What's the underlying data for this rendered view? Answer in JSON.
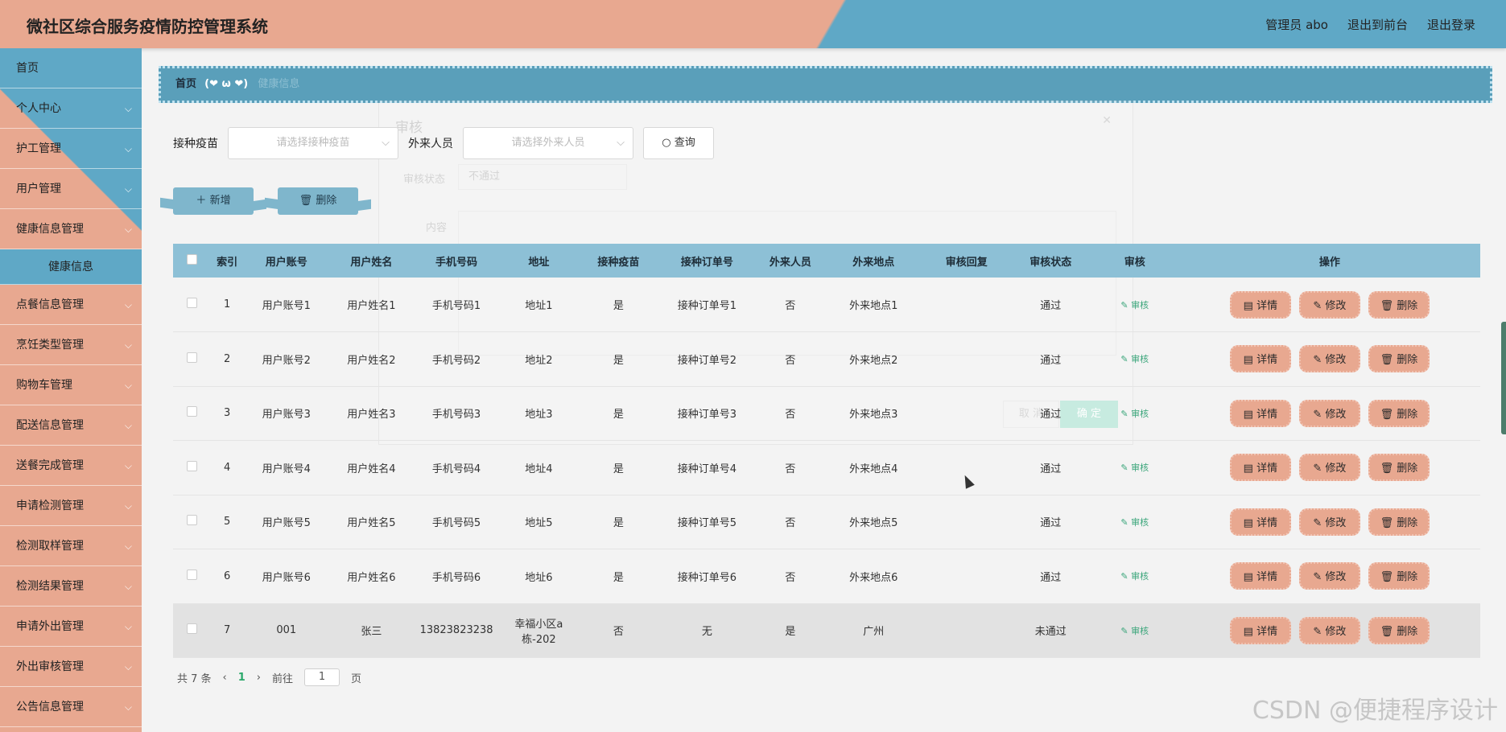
{
  "header": {
    "title": "微社区综合服务疫情防控管理系统",
    "user": "管理员 abo",
    "front": "退出到前台",
    "logout": "退出登录"
  },
  "sidebar": {
    "items": [
      {
        "label": "首页",
        "chevron": false
      },
      {
        "label": "个人中心",
        "chevron": true
      },
      {
        "label": "护工管理",
        "chevron": true
      },
      {
        "label": "用户管理",
        "chevron": true
      },
      {
        "label": "健康信息管理",
        "chevron": true
      },
      {
        "label": "健康信息",
        "chevron": false,
        "sub": true
      },
      {
        "label": "点餐信息管理",
        "chevron": true
      },
      {
        "label": "烹饪类型管理",
        "chevron": true
      },
      {
        "label": "购物车管理",
        "chevron": true
      },
      {
        "label": "配送信息管理",
        "chevron": true
      },
      {
        "label": "送餐完成管理",
        "chevron": true
      },
      {
        "label": "申请检测管理",
        "chevron": true
      },
      {
        "label": "检测取样管理",
        "chevron": true
      },
      {
        "label": "检测结果管理",
        "chevron": true
      },
      {
        "label": "申请外出管理",
        "chevron": true
      },
      {
        "label": "外出审核管理",
        "chevron": true
      },
      {
        "label": "公告信息管理",
        "chevron": true
      }
    ]
  },
  "breadcrumb": {
    "home": "首页",
    "face": "(❤ ω ❤)",
    "current": "健康信息"
  },
  "filters": {
    "vaccine_label": "接种疫苗",
    "vaccine_placeholder": "请选择接种疫苗",
    "visitor_label": "外来人员",
    "visitor_placeholder": "请选择外来人员",
    "search": "查询"
  },
  "actions": {
    "add": "新增",
    "delete": "删除"
  },
  "table": {
    "headers": [
      "索引",
      "用户账号",
      "用户姓名",
      "手机号码",
      "地址",
      "接种疫苗",
      "接种订单号",
      "外来人员",
      "外来地点",
      "审核回复",
      "审核状态",
      "审核",
      "操作"
    ],
    "rows": [
      {
        "idx": "1",
        "account": "用户账号1",
        "name": "用户姓名1",
        "phone": "手机号码1",
        "addr": "地址1",
        "vac": "是",
        "order": "接种订单号1",
        "visitor": "否",
        "place": "外来地点1",
        "reply": "",
        "status": "通过"
      },
      {
        "idx": "2",
        "account": "用户账号2",
        "name": "用户姓名2",
        "phone": "手机号码2",
        "addr": "地址2",
        "vac": "是",
        "order": "接种订单号2",
        "visitor": "否",
        "place": "外来地点2",
        "reply": "",
        "status": "通过"
      },
      {
        "idx": "3",
        "account": "用户账号3",
        "name": "用户姓名3",
        "phone": "手机号码3",
        "addr": "地址3",
        "vac": "是",
        "order": "接种订单号3",
        "visitor": "否",
        "place": "外来地点3",
        "reply": "",
        "status": "通过"
      },
      {
        "idx": "4",
        "account": "用户账号4",
        "name": "用户姓名4",
        "phone": "手机号码4",
        "addr": "地址4",
        "vac": "是",
        "order": "接种订单号4",
        "visitor": "否",
        "place": "外来地点4",
        "reply": "",
        "status": "通过"
      },
      {
        "idx": "5",
        "account": "用户账号5",
        "name": "用户姓名5",
        "phone": "手机号码5",
        "addr": "地址5",
        "vac": "是",
        "order": "接种订单号5",
        "visitor": "否",
        "place": "外来地点5",
        "reply": "",
        "status": "通过"
      },
      {
        "idx": "6",
        "account": "用户账号6",
        "name": "用户姓名6",
        "phone": "手机号码6",
        "addr": "地址6",
        "vac": "是",
        "order": "接种订单号6",
        "visitor": "否",
        "place": "外来地点6",
        "reply": "",
        "status": "通过"
      },
      {
        "idx": "7",
        "account": "001",
        "name": "张三",
        "phone": "13823823238",
        "addr": "幸福小区a栋-202",
        "vac": "否",
        "order": "无",
        "visitor": "是",
        "place": "广州",
        "reply": "",
        "status": "未通过"
      }
    ],
    "audit_label": "审核",
    "op_detail": "详情",
    "op_edit": "修改",
    "op_delete": "删除"
  },
  "pager": {
    "total": "共 7 条",
    "page": "1",
    "goto": "前往",
    "goto_value": "1",
    "page_unit": "页"
  },
  "dialog": {
    "title": "审核",
    "status_label": "审核状态",
    "status_value": "不通过",
    "content_label": "内容",
    "cancel": "取 消",
    "ok": "确 定"
  },
  "watermark": "CSDN @便捷程序设计"
}
